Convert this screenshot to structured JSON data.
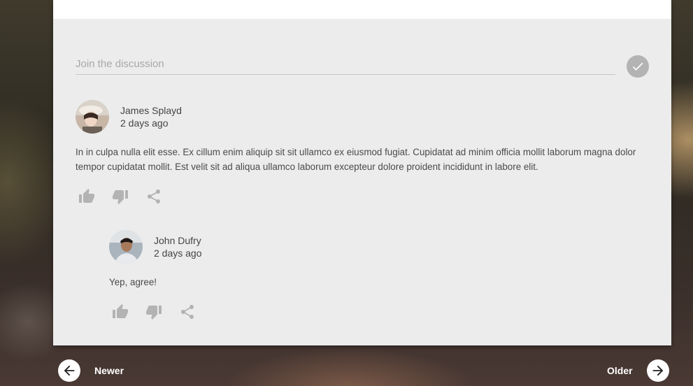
{
  "discussion": {
    "input_placeholder": "Join the discussion",
    "input_value": "",
    "submit_icon": "check-icon"
  },
  "comments": [
    {
      "author": "James Splayd",
      "time": "2 days ago",
      "text": "In in culpa nulla elit esse. Ex cillum enim aliquip sit sit ullamco ex eiusmod fugiat. Cupidatat ad minim officia mollit laborum magna dolor tempor cupidatat mollit. Est velit sit ad aliqua ullamco laborum excepteur dolore proident incididunt in labore elit.",
      "actions": [
        "thumb-up-icon",
        "thumb-down-icon",
        "share-icon"
      ]
    },
    {
      "author": "John Dufry",
      "time": "2 days ago",
      "text": "Yep, agree!",
      "actions": [
        "thumb-up-icon",
        "thumb-down-icon",
        "share-icon"
      ]
    }
  ],
  "pagination": {
    "newer_label": "Newer",
    "older_label": "Older"
  },
  "colors": {
    "card_background": "#ececec",
    "icon_gray": "#b3b3b3",
    "text_gray": "#4a4a4a"
  }
}
